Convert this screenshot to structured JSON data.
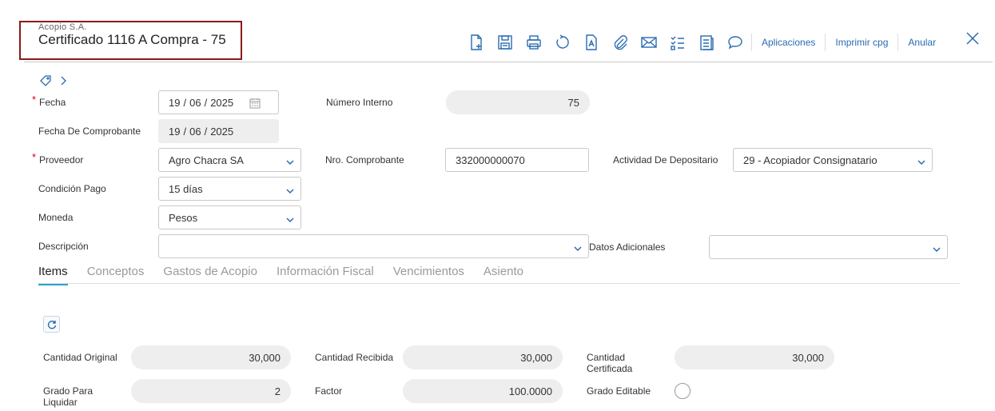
{
  "header": {
    "company": "Acopio S.A.",
    "title": "Certificado 1116 A Compra - 75"
  },
  "toolbar": {
    "icons": [
      "new-document-icon",
      "save-icon",
      "print-icon",
      "refresh-icon",
      "report-icon",
      "attachment-icon",
      "email-icon",
      "checklist-icon",
      "notes-icon",
      "comment-icon"
    ],
    "links": {
      "aplicaciones": "Aplicaciones",
      "imprimir": "Imprimir cpg",
      "anular": "Anular"
    }
  },
  "form": {
    "fecha": {
      "label": "Fecha",
      "day": "19",
      "month": "06",
      "year": "2025",
      "sep": "/"
    },
    "numero_interno": {
      "label": "Número Interno",
      "value": "75"
    },
    "fecha_comprobante": {
      "label": "Fecha De Comprobante",
      "day": "19",
      "month": "06",
      "year": "2025",
      "sep": "/"
    },
    "proveedor": {
      "label": "Proveedor",
      "value": "Agro Chacra SA"
    },
    "nro_comprobante": {
      "label": "Nro. Comprobante",
      "value": "332000000070"
    },
    "actividad": {
      "label": "Actividad De Depositario",
      "value": "29 - Acopiador Consignatario"
    },
    "condicion_pago": {
      "label": "Condición Pago",
      "value": "15 días"
    },
    "moneda": {
      "label": "Moneda",
      "value": "Pesos"
    },
    "descripcion": {
      "label": "Descripción",
      "value": ""
    },
    "datos_adicionales": {
      "label": "Datos Adicionales",
      "value": ""
    },
    "required_mark": "*"
  },
  "tabs": [
    {
      "label": "Items",
      "active": true
    },
    {
      "label": "Conceptos",
      "active": false
    },
    {
      "label": "Gastos de Acopio",
      "active": false
    },
    {
      "label": "Información Fiscal",
      "active": false
    },
    {
      "label": "Vencimientos",
      "active": false
    },
    {
      "label": "Asiento",
      "active": false
    }
  ],
  "items": {
    "cantidad_original": {
      "label": "Cantidad Original",
      "value": "30,000"
    },
    "cantidad_recibida": {
      "label": "Cantidad Recibida",
      "value": "30,000"
    },
    "cantidad_certificada": {
      "label_line1": "Cantidad",
      "label_line2": "Certificada",
      "value": "30,000"
    },
    "grado_liquidar": {
      "label_line1": "Grado Para",
      "label_line2": "Liquidar",
      "value": "2"
    },
    "factor": {
      "label": "Factor",
      "value": "100.0000"
    },
    "grado_editable": {
      "label": "Grado Editable"
    }
  },
  "colors": {
    "accent": "#2a6bb0",
    "tab_underline": "#2aa3c9",
    "title_border": "#8b1a1a",
    "required": "#d0021b"
  }
}
